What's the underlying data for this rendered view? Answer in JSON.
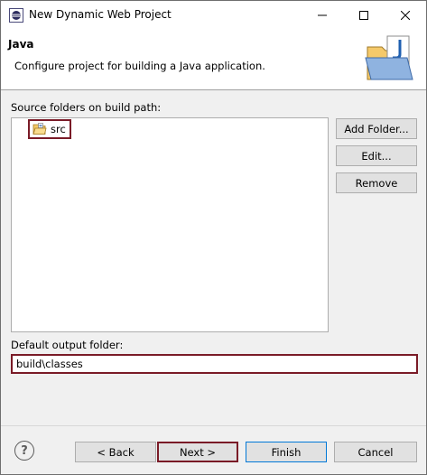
{
  "window": {
    "title": "New Dynamic Web Project",
    "icons": {
      "app": "eclipse-icon",
      "minimize": "minimize-icon",
      "maximize": "maximize-icon",
      "close": "close-icon"
    }
  },
  "header": {
    "title": "Java",
    "description": "Configure project for building a Java application.",
    "image": "java-folder-wizard-icon"
  },
  "source": {
    "label": "Source folders on build path:",
    "items": [
      {
        "label": "src",
        "icon": "source-folder-icon"
      }
    ]
  },
  "side_buttons": {
    "add": "Add Folder...",
    "edit": "Edit...",
    "remove": "Remove"
  },
  "output": {
    "label": "Default output folder:",
    "value": "build\\classes"
  },
  "footer": {
    "help": "?",
    "back": "< Back",
    "next": "Next >",
    "finish": "Finish",
    "cancel": "Cancel"
  },
  "colors": {
    "highlight_border": "#7a1b27",
    "default_button_border": "#0078d7",
    "dialog_bg": "#f0f0f0"
  }
}
